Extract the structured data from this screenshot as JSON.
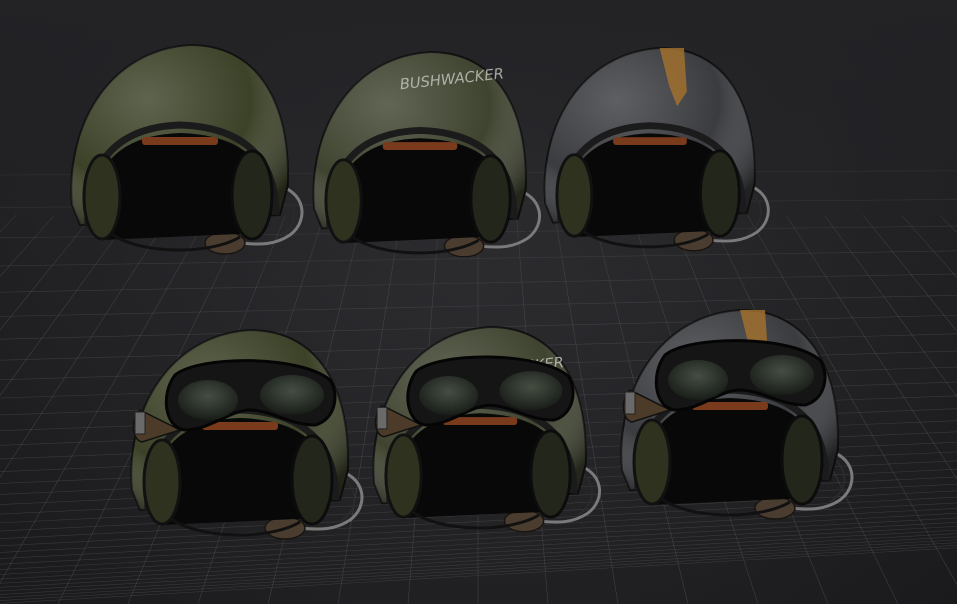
{
  "scene": {
    "background_color": "#232326",
    "grid_color": "#5a5a60",
    "helmets": [
      {
        "id": "helmet-1",
        "variant": "plain",
        "shell_color": "#3c4228",
        "goggles": false,
        "decal": ""
      },
      {
        "id": "helmet-2",
        "variant": "worn-olive",
        "shell_color": "#3f4430",
        "goggles": false,
        "decal": "BUSHWACKER"
      },
      {
        "id": "helmet-3",
        "variant": "grey-orange-stripe",
        "shell_color": "#3a3c40",
        "goggles": false,
        "decal": ""
      },
      {
        "id": "helmet-4",
        "variant": "plain-with-goggles",
        "shell_color": "#3c4228",
        "goggles": true,
        "decal": ""
      },
      {
        "id": "helmet-5",
        "variant": "worn-olive-with-goggles",
        "shell_color": "#3f4430",
        "goggles": true,
        "decal": "BUSHWACKER"
      },
      {
        "id": "helmet-6",
        "variant": "grey-orange-stripe-with-goggles",
        "shell_color": "#3a3c40",
        "goggles": true,
        "decal": ""
      }
    ]
  }
}
